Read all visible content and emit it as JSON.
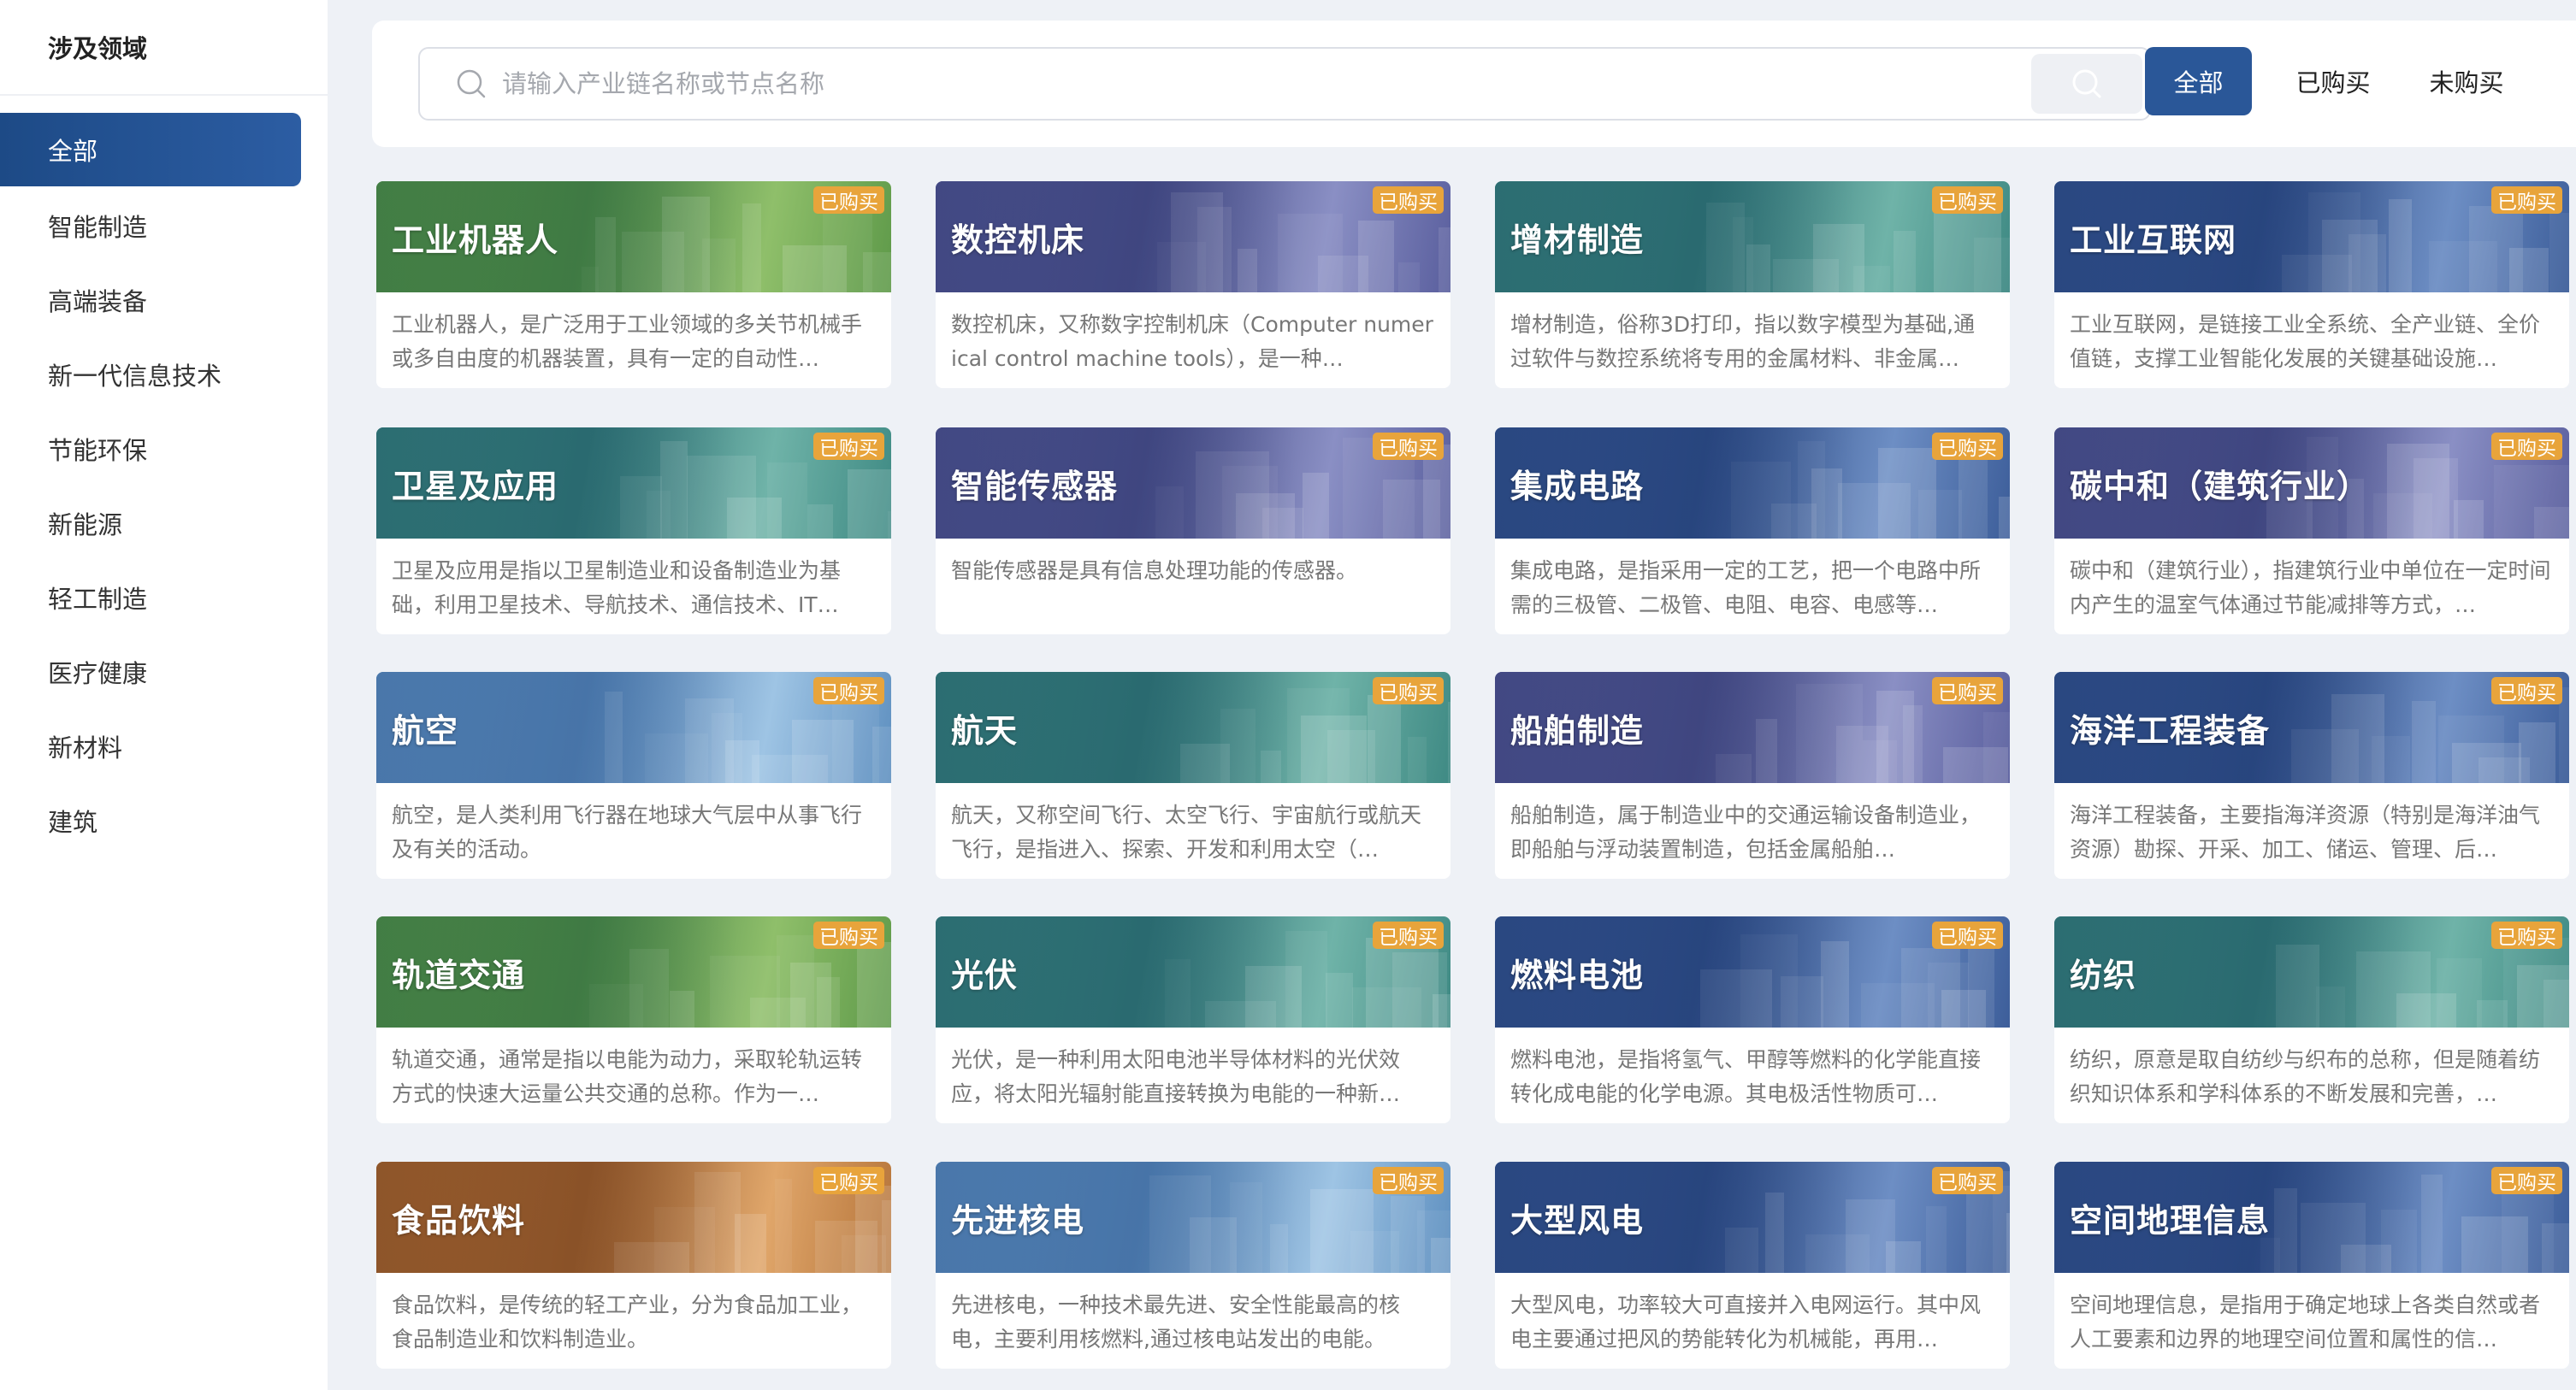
{
  "sidebar": {
    "title": "涉及领域",
    "items": [
      {
        "label": "全部",
        "active": true
      },
      {
        "label": "智能制造"
      },
      {
        "label": "高端装备"
      },
      {
        "label": "新一代信息技术"
      },
      {
        "label": "节能环保"
      },
      {
        "label": "新能源"
      },
      {
        "label": "轻工制造"
      },
      {
        "label": "医疗健康"
      },
      {
        "label": "新材料"
      },
      {
        "label": "建筑"
      }
    ]
  },
  "search": {
    "placeholder": "请输入产业链名称或节点名称",
    "value": ""
  },
  "filters": {
    "all": "全部",
    "bought": "已购买",
    "unbought": "未购买"
  },
  "badge_label": "已购买",
  "colors": {
    "accent": "#2a5798",
    "badge": "#e8a43b",
    "sidebar_active": "#1d4a86"
  },
  "cards": [
    {
      "title": "工业机器人",
      "desc": "工业机器人，是广泛用于工业领域的多关节机械手或多自由度的机器装置，具有一定的自动性…",
      "theme": "green"
    },
    {
      "title": "数控机床",
      "desc": "数控机床，又称数字控制机床（Computer numerical control machine tools），是一种…",
      "theme": "purple"
    },
    {
      "title": "增材制造",
      "desc": "增材制造，俗称3D打印，指以数字模型为基础,通过软件与数控系统将专用的金属材料、非金属…",
      "theme": "teal"
    },
    {
      "title": "工业互联网",
      "desc": "工业互联网，是链接工业全系统、全产业链、全价值链，支撑工业智能化发展的关键基础设施…",
      "theme": "blue"
    },
    {
      "title": "卫星及应用",
      "desc": "卫星及应用是指以卫星制造业和设备制造业为基础，利用卫星技术、导航技术、通信技术、IT…",
      "theme": "teal"
    },
    {
      "title": "智能传感器",
      "desc": "智能传感器是具有信息处理功能的传感器。",
      "theme": "purple"
    },
    {
      "title": "集成电路",
      "desc": "集成电路，是指采用一定的工艺，把一个电路中所需的三极管、二极管、电阻、电容、电感等…",
      "theme": "blue"
    },
    {
      "title": "碳中和（建筑行业）",
      "desc": "碳中和（建筑行业），指建筑行业中单位在一定时间内产生的温室气体通过节能减排等方式，…",
      "theme": "purple"
    },
    {
      "title": "航空",
      "desc": "航空，是人类利用飞行器在地球大气层中从事飞行及有关的活动。",
      "theme": "skyblue"
    },
    {
      "title": "航天",
      "desc": "航天，又称空间飞行、太空飞行、宇宙航行或航天飞行，是指进入、探索、开发和利用太空（…",
      "theme": "teal"
    },
    {
      "title": "船舶制造",
      "desc": "船舶制造，属于制造业中的交通运输设备制造业，即船舶与浮动装置制造，包括金属船舶…",
      "theme": "purple"
    },
    {
      "title": "海洋工程装备",
      "desc": "海洋工程装备，主要指海洋资源（特别是海洋油气资源）勘探、开采、加工、储运、管理、后…",
      "theme": "blue"
    },
    {
      "title": "轨道交通",
      "desc": "轨道交通，通常是指以电能为动力，采取轮轨运转方式的快速大运量公共交通的总称。作为一…",
      "theme": "green"
    },
    {
      "title": "光伏",
      "desc": "光伏，是一种利用太阳电池半导体材料的光伏效应，将太阳光辐射能直接转换为电能的一种新…",
      "theme": "teal"
    },
    {
      "title": "燃料电池",
      "desc": "燃料电池，是指将氢气、甲醇等燃料的化学能直接转化成电能的化学电源。其电极活性物质可…",
      "theme": "blue"
    },
    {
      "title": "纺织",
      "desc": "纺织，原意是取自纺纱与织布的总称，但是随着纺织知识体系和学科体系的不断发展和完善，…",
      "theme": "teal"
    },
    {
      "title": "食品饮料",
      "desc": "食品饮料，是传统的轻工产业，分为食品加工业，食品制造业和饮料制造业。",
      "theme": "orange"
    },
    {
      "title": "先进核电",
      "desc": "先进核电，一种技术最先进、安全性能最高的核电，主要利用核燃料,通过核电站发出的电能。",
      "theme": "skyblue"
    },
    {
      "title": "大型风电",
      "desc": "大型风电，功率较大可直接并入电网运行。其中风电主要通过把风的势能转化为机械能，再用…",
      "theme": "blue"
    },
    {
      "title": "空间地理信息",
      "desc": "空间地理信息，是指用于确定地球上各类自然或者人工要素和边界的地理空间位置和属性的信…",
      "theme": "blue"
    }
  ]
}
